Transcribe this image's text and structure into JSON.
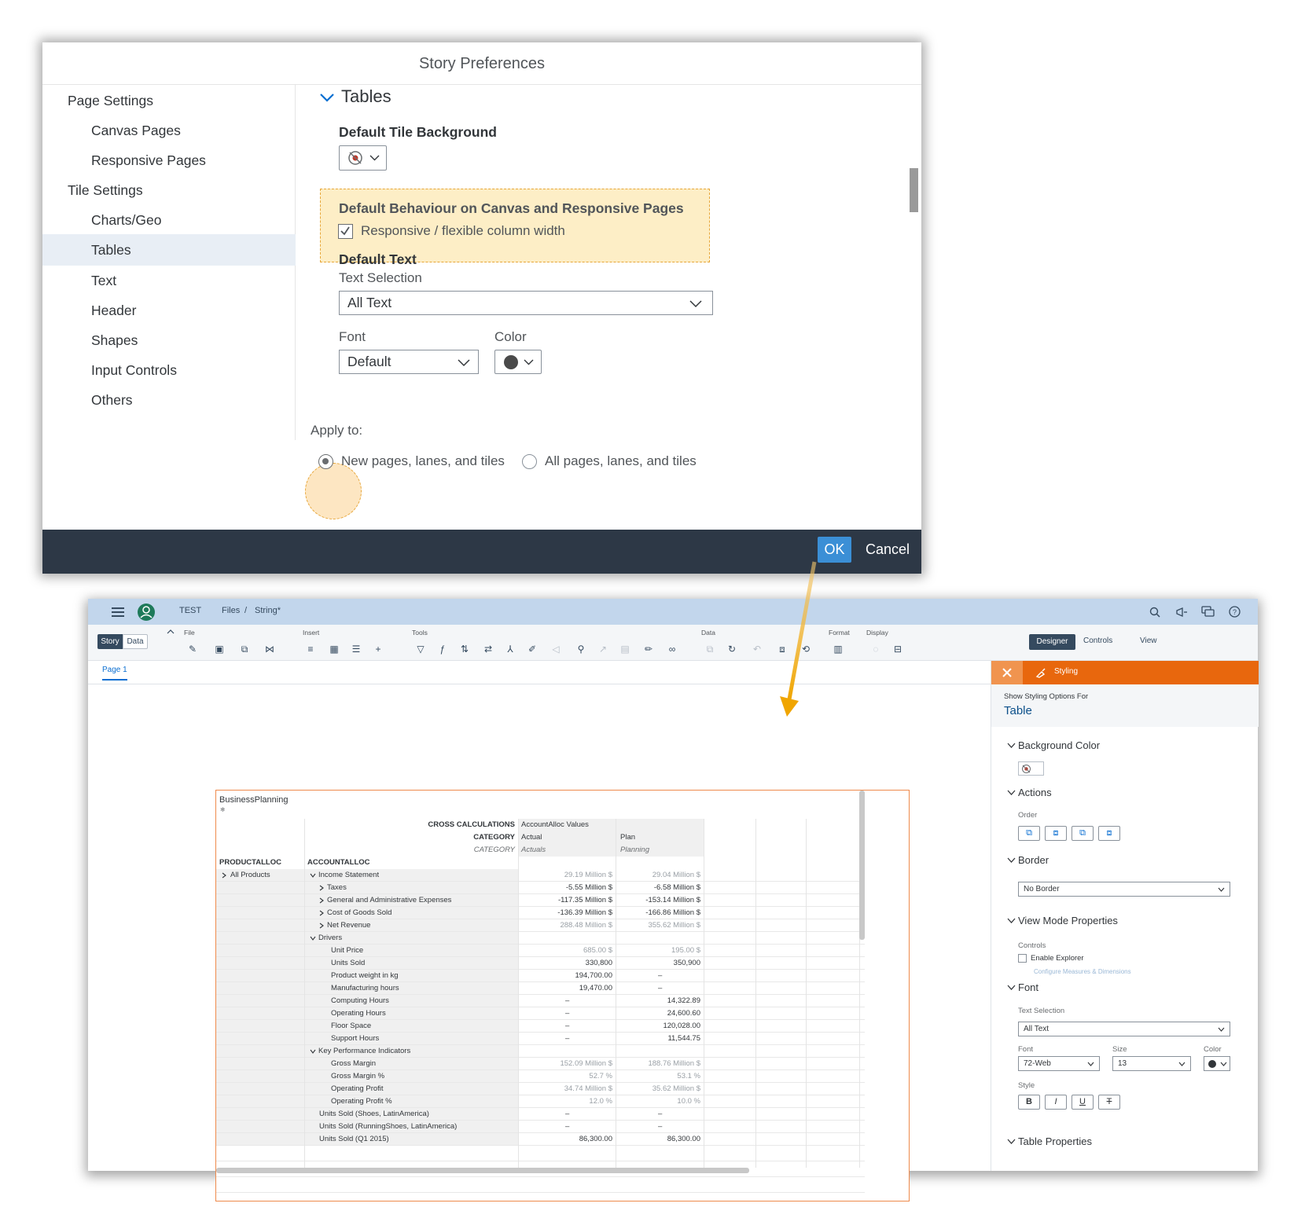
{
  "dialog": {
    "title": "Story Preferences",
    "nav": [
      {
        "label": "Page Settings",
        "level": 1
      },
      {
        "label": "Canvas Pages",
        "level": 2
      },
      {
        "label": "Responsive Pages",
        "level": 2
      },
      {
        "label": "Tile Settings",
        "level": 1
      },
      {
        "label": "Charts/Geo",
        "level": 2
      },
      {
        "label": "Tables",
        "level": 2,
        "selected": true
      },
      {
        "label": "Text",
        "level": 2
      },
      {
        "label": "Header",
        "level": 2
      },
      {
        "label": "Shapes",
        "level": 2
      },
      {
        "label": "Input Controls",
        "level": 2
      },
      {
        "label": "Others",
        "level": 2
      }
    ],
    "section_title": "Tables",
    "default_tile_background_label": "Default Tile Background",
    "behaviour_title": "Default Behaviour on Canvas and Responsive Pages",
    "responsive_checkbox_label": "Responsive / flexible column width",
    "responsive_checked": true,
    "default_text_label": "Default Text",
    "text_selection_label": "Text Selection",
    "text_selection_value": "All Text",
    "font_label": "Font",
    "font_value": "Default",
    "color_label": "Color",
    "color_value": "#4a4a4a",
    "apply_to_label": "Apply to:",
    "apply_options": [
      "New pages, lanes, and tiles",
      "All pages, lanes, and tiles"
    ],
    "apply_selected": 0,
    "ok_label": "OK",
    "cancel_label": "Cancel"
  },
  "app": {
    "shell": {
      "breadcrumb_root": "TEST",
      "breadcrumb_files": "Files",
      "breadcrumb_sep": "/",
      "breadcrumb_current": "String*"
    },
    "toolbar": {
      "story_tab": "Story",
      "data_tab": "Data",
      "groups": [
        "File",
        "Insert",
        "Tools",
        "Data",
        "Format",
        "Display"
      ],
      "designer_label": "Designer",
      "controls_label": "Controls",
      "view_label": "View"
    },
    "page_tab": "Page 1",
    "table": {
      "title": "BusinessPlanning",
      "header_rows": [
        {
          "label": "CROSS CALCULATIONS",
          "c1": "AccountAlloc Values",
          "c2": ""
        },
        {
          "label": "CATEGORY",
          "c1": "Actual",
          "c2": "Plan"
        },
        {
          "label": "CATEGORY",
          "c1": "Actuals",
          "c2": "Planning"
        }
      ],
      "dim_headers": [
        "PRODUCTALLOC",
        "ACCOUNTALLOC"
      ],
      "rows": [
        {
          "p": "All Products",
          "a": "Income Statement",
          "v1": "29.19 Million $",
          "v2": "29.04 Million $",
          "indent": 0,
          "exp": "down",
          "gray": true
        },
        {
          "p": "",
          "a": "Taxes",
          "v1": "-5.55 Million $",
          "v2": "-6.58 Million $",
          "indent": 1,
          "exp": "right"
        },
        {
          "p": "",
          "a": "General and Administrative Expenses",
          "v1": "-117.35 Million $",
          "v2": "-153.14 Million $",
          "indent": 1,
          "exp": "right"
        },
        {
          "p": "",
          "a": "Cost of Goods Sold",
          "v1": "-136.39 Million $",
          "v2": "-166.86 Million $",
          "indent": 1,
          "exp": "right"
        },
        {
          "p": "",
          "a": "Net Revenue",
          "v1": "288.48 Million $",
          "v2": "355.62 Million $",
          "indent": 1,
          "exp": "right",
          "gray": true
        },
        {
          "p": "",
          "a": "Drivers",
          "v1": "",
          "v2": "",
          "indent": 0,
          "exp": "down"
        },
        {
          "p": "",
          "a": "Unit Price",
          "v1": "685.00 $",
          "v2": "195.00 $",
          "indent": 2,
          "gray": true
        },
        {
          "p": "",
          "a": "Units Sold",
          "v1": "330,800",
          "v2": "350,900",
          "indent": 2
        },
        {
          "p": "",
          "a": "Product weight in kg",
          "v1": "194,700.00",
          "v2": "–",
          "indent": 2
        },
        {
          "p": "",
          "a": "Manufacturing hours",
          "v1": "19,470.00",
          "v2": "–",
          "indent": 2
        },
        {
          "p": "",
          "a": "Computing Hours",
          "v1": "–",
          "v2": "14,322.89",
          "indent": 2
        },
        {
          "p": "",
          "a": "Operating Hours",
          "v1": "–",
          "v2": "24,600.60",
          "indent": 2
        },
        {
          "p": "",
          "a": "Floor Space",
          "v1": "–",
          "v2": "120,028.00",
          "indent": 2
        },
        {
          "p": "",
          "a": "Support Hours",
          "v1": "–",
          "v2": "11,544.75",
          "indent": 2
        },
        {
          "p": "",
          "a": "Key Performance Indicators",
          "v1": "",
          "v2": "",
          "indent": 0,
          "exp": "down"
        },
        {
          "p": "",
          "a": "Gross Margin",
          "v1": "152.09 Million $",
          "v2": "188.76 Million $",
          "indent": 2,
          "gray": true
        },
        {
          "p": "",
          "a": "Gross Margin %",
          "v1": "52.7 %",
          "v2": "53.1 %",
          "indent": 2,
          "gray": true
        },
        {
          "p": "",
          "a": "Operating Profit",
          "v1": "34.74 Million $",
          "v2": "35.62 Million $",
          "indent": 2,
          "gray": true
        },
        {
          "p": "",
          "a": "Operating Profit %",
          "v1": "12.0 %",
          "v2": "10.0 %",
          "indent": 2,
          "gray": true
        },
        {
          "p": "",
          "a": "Units Sold (Shoes, LatinAmerica)",
          "v1": "–",
          "v2": "–",
          "indent": 1
        },
        {
          "p": "",
          "a": "Units Sold (RunningShoes, LatinAmerica)",
          "v1": "–",
          "v2": "–",
          "indent": 1
        },
        {
          "p": "",
          "a": "Units Sold (Q1 2015)",
          "v1": "86,300.00",
          "v2": "86,300.00",
          "indent": 1
        }
      ]
    },
    "panel": {
      "tab_label": "Styling",
      "show_for_label": "Show Styling Options For",
      "show_for_value": "Table",
      "background_color": "Background Color",
      "actions": "Actions",
      "order_label": "Order",
      "border": "Border",
      "border_value": "No Border",
      "view_mode": "View Mode Properties",
      "controls_label": "Controls",
      "enable_explorer": "Enable Explorer",
      "configure_link": "Configure Measures & Dimensions",
      "font_section": "Font",
      "text_selection_label": "Text Selection",
      "text_selection_value": "All Text",
      "font_label": "Font",
      "font_value": "72-Web",
      "size_label": "Size",
      "size_value": "13",
      "color_label": "Color",
      "style_label": "Style",
      "style_buttons": [
        "B",
        "I",
        "U",
        "T"
      ],
      "table_properties": "Table Properties",
      "accent_color": "#e8670d"
    }
  }
}
